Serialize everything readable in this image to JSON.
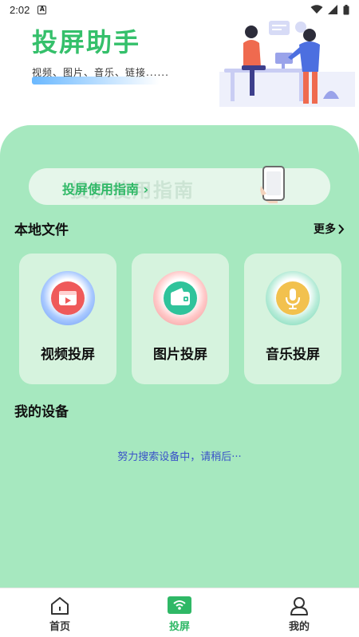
{
  "status_bar": {
    "time": "2:02",
    "notification_icon": "a-icon",
    "battery_icon": "battery-icon"
  },
  "header": {
    "title": "投屏助手",
    "subtitle": "视频、图片、音乐、链接......"
  },
  "guide": {
    "label": "投屏使用指南",
    "shadow_text": "投屏使用指南"
  },
  "local_files": {
    "title": "本地文件",
    "more": "更多",
    "items": [
      {
        "label": "视频投屏",
        "icon": "video-icon",
        "color": "#ef5a5a"
      },
      {
        "label": "图片投屏",
        "icon": "image-icon",
        "color": "#2fc39b"
      },
      {
        "label": "音乐投屏",
        "icon": "microphone-icon",
        "color": "#f2c14e"
      }
    ]
  },
  "devices": {
    "title": "我的设备",
    "status": "努力搜索设备中，请稍后···"
  },
  "bottom_nav": {
    "items": [
      {
        "label": "首页",
        "icon": "home-icon"
      },
      {
        "label": "投屏",
        "icon": "cast-icon",
        "active": true
      },
      {
        "label": "我的",
        "icon": "user-icon"
      }
    ]
  },
  "colors": {
    "accent": "#2fb866",
    "panel": "#a6e8bf",
    "card": "#d6f3de",
    "searching_text": "#3a52c8"
  }
}
